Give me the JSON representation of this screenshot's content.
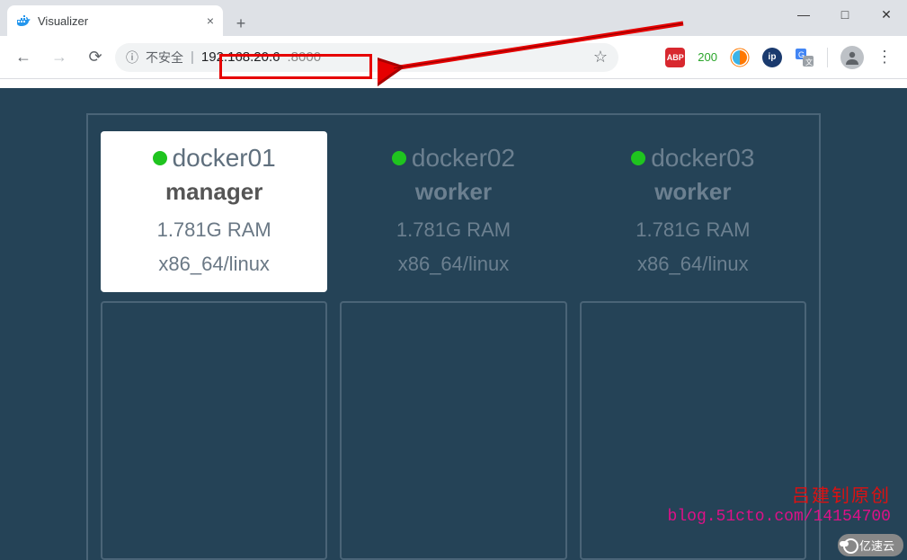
{
  "tab": {
    "title": "Visualizer"
  },
  "window": {
    "minimize": "—",
    "maximize": "□",
    "close": "✕"
  },
  "toolbar": {
    "insecure_label": "不安全",
    "url_host": "192.168.20.6",
    "url_port": ":8000"
  },
  "extensions": {
    "abp": "ABP",
    "count": "200",
    "ip": "ip"
  },
  "nodes": [
    {
      "name": "docker01",
      "role": "manager",
      "ram": "1.781G RAM",
      "arch": "x86_64/linux",
      "selected": true
    },
    {
      "name": "docker02",
      "role": "worker",
      "ram": "1.781G RAM",
      "arch": "x86_64/linux",
      "selected": false
    },
    {
      "name": "docker03",
      "role": "worker",
      "ram": "1.781G RAM",
      "arch": "x86_64/linux",
      "selected": false
    }
  ],
  "watermark": {
    "line1": "吕建钊原创",
    "line2": "blog.51cto.com/14154700"
  },
  "corner_badge": "亿速云"
}
